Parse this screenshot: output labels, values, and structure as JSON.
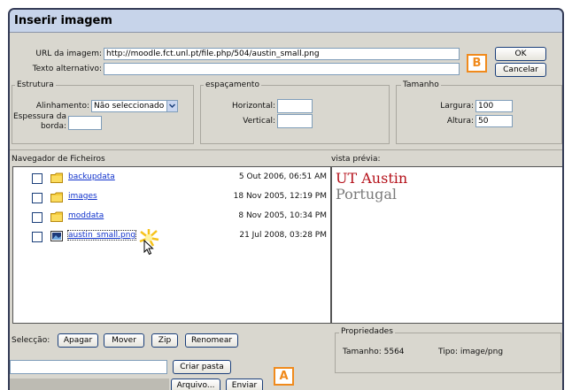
{
  "dialog": {
    "title": "Inserir imagem"
  },
  "url": {
    "label": "URL da imagem:",
    "value": "http://moodle.fct.unl.pt/file.php/504/austin_small.png"
  },
  "alt": {
    "label": "Texto alternativo:",
    "value": ""
  },
  "buttons": {
    "ok": "OK",
    "cancel": "Cancelar"
  },
  "estrutura": {
    "legend": "Estrutura",
    "align_label": "Alinhamento:",
    "align_value": "Não seleccionado",
    "border_label_1": "Espessura da",
    "border_label_2": "borda:",
    "border_value": ""
  },
  "espacamento": {
    "legend": "espaçamento",
    "horizontal_label": "Horizontal:",
    "horizontal_value": "",
    "vertical_label": "Vertical:",
    "vertical_value": ""
  },
  "tamanho": {
    "legend": "Tamanho",
    "width_label": "Largura:",
    "width_value": "100",
    "height_label": "Altura:",
    "height_value": "50"
  },
  "browser": {
    "label": "Navegador de Ficheiros",
    "items": [
      {
        "name": "backupdata",
        "date": "5 Out 2006, 06:51 AM",
        "icon": "folder-icon"
      },
      {
        "name": "images",
        "date": "18 Nov 2005, 12:19 PM",
        "icon": "folder-icon"
      },
      {
        "name": "moddata",
        "date": "8 Nov 2005, 10:34 PM",
        "icon": "folder-icon"
      },
      {
        "name": "austin_small.png",
        "date": "21 Jul 2008, 03:28 PM",
        "icon": "image-file-icon"
      }
    ]
  },
  "preview": {
    "label": "vista prévia:",
    "line1": "UT Austin",
    "line2": "Portugal",
    "color1": "#b5121b",
    "color2": "#7a7a7a"
  },
  "selection": {
    "label": "Selecção:",
    "delete": "Apagar",
    "move": "Mover",
    "zip": "Zip",
    "rename": "Renomear"
  },
  "folder": {
    "value": "",
    "create": "Criar pasta"
  },
  "upload": {
    "browse": "Arquivo...",
    "send": "Enviar"
  },
  "properties": {
    "legend": "Propriedades",
    "size_label": "Tamanho: 5564",
    "type_label": "Tipo: image/png"
  },
  "annotations": {
    "a": "A",
    "b": "B",
    "color": "#f08a1c"
  }
}
